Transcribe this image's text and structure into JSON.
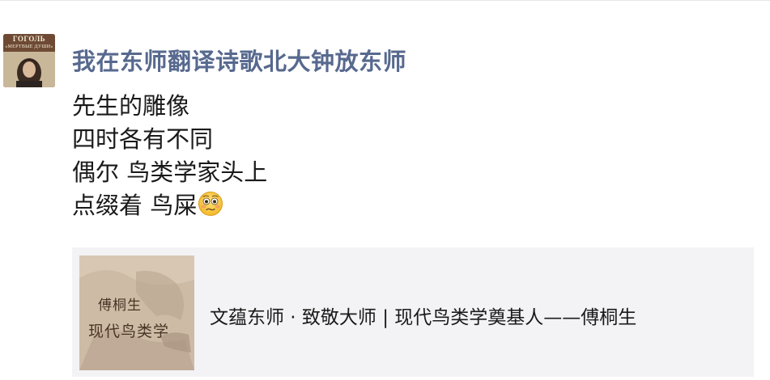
{
  "poster": {
    "name": "我在东师翻译诗歌北大钟放东师",
    "avatar": {
      "title": "ГОГОЛЬ",
      "subtitle": "«МЕРТВЫЕ ДУШИ»"
    }
  },
  "post": {
    "lines": [
      "先生的雕像",
      "四时各有不同",
      "偶尔 鸟类学家头上",
      "点缀着 鸟屎"
    ],
    "emoji": "flushed-face-emoji"
  },
  "link_card": {
    "thumbnail_line1": "傅桐生",
    "thumbnail_line2": "现代鸟类学",
    "title": "文蕴东师 · 致敬大师 | 现代鸟类学奠基人——傅桐生"
  },
  "colors": {
    "name": "#57698e",
    "body_text": "#1a1a1a",
    "card_bg": "#f3f3f5"
  }
}
